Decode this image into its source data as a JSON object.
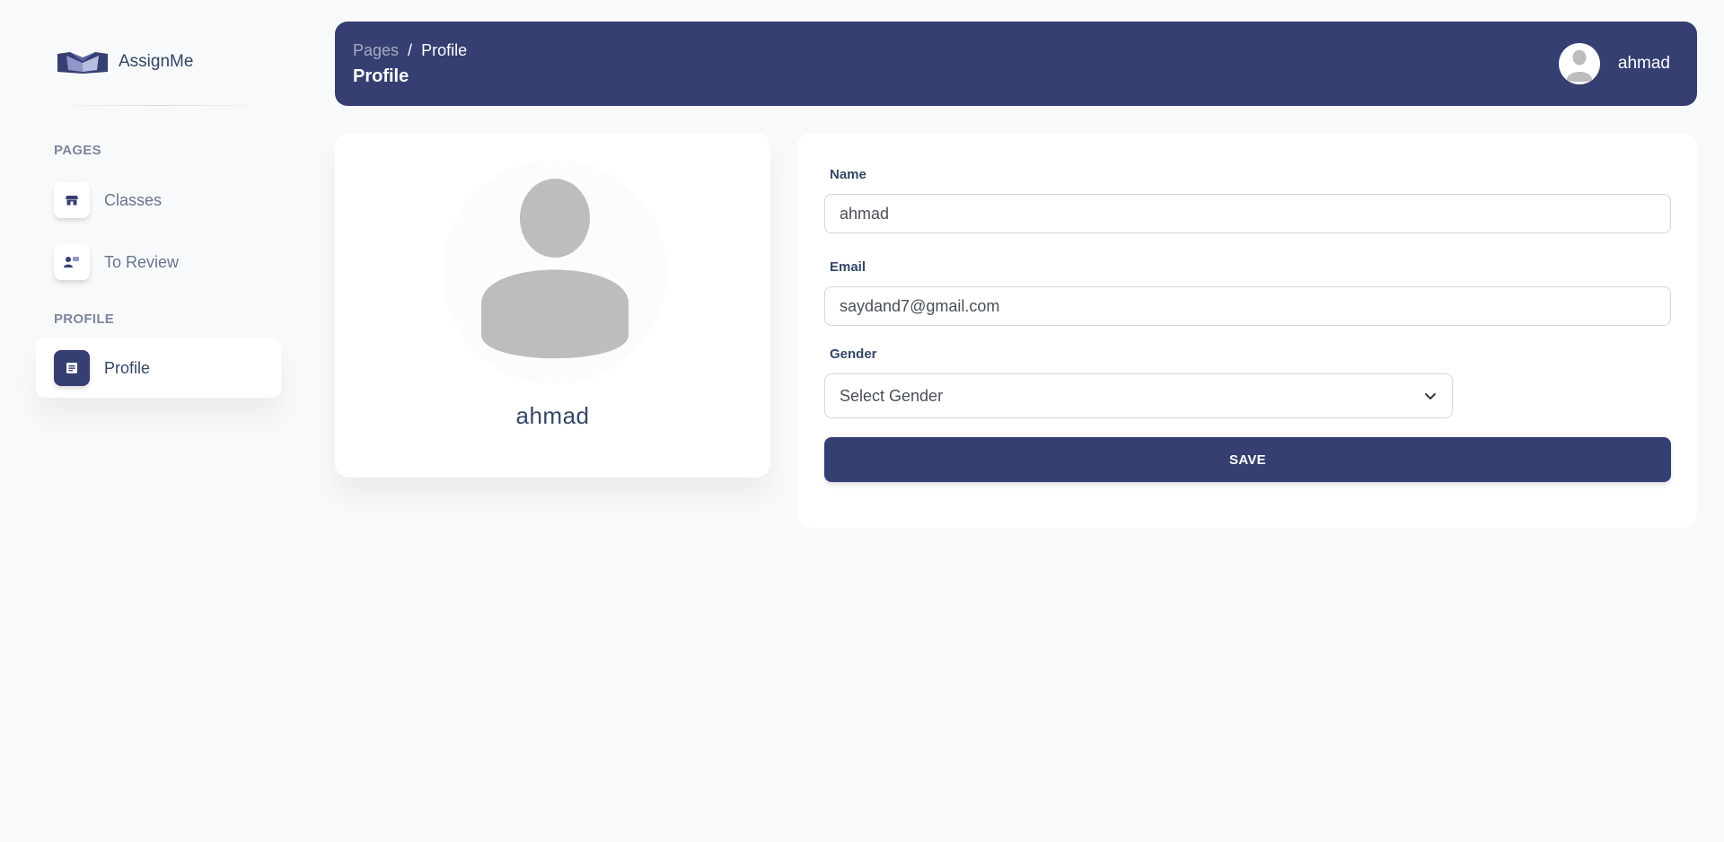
{
  "brand": {
    "name": "AssignMe",
    "logo_icon": "open-book-logo"
  },
  "sidebar": {
    "sections": [
      {
        "title": "PAGES"
      },
      {
        "title": "PROFILE"
      }
    ],
    "items": [
      {
        "label": "Classes",
        "icon": "store-icon",
        "active": false
      },
      {
        "label": "To Review",
        "icon": "user-review-icon",
        "active": false
      },
      {
        "label": "Profile",
        "icon": "document-icon",
        "active": true
      }
    ]
  },
  "header": {
    "breadcrumb_root": "Pages",
    "breadcrumb_separator": "/",
    "breadcrumb_current": "Profile",
    "title": "Profile",
    "username": "ahmad"
  },
  "profile_card": {
    "name": "ahmad"
  },
  "form": {
    "name_label": "Name",
    "name_value": "ahmad",
    "email_label": "Email",
    "email_value": "saydand7@gmail.com",
    "gender_label": "Gender",
    "gender_value": "Select Gender",
    "save_label": "SAVE"
  },
  "colors": {
    "primary": "#363f72",
    "background": "#f8f9fa",
    "text": "#344767",
    "muted": "#67748e"
  }
}
